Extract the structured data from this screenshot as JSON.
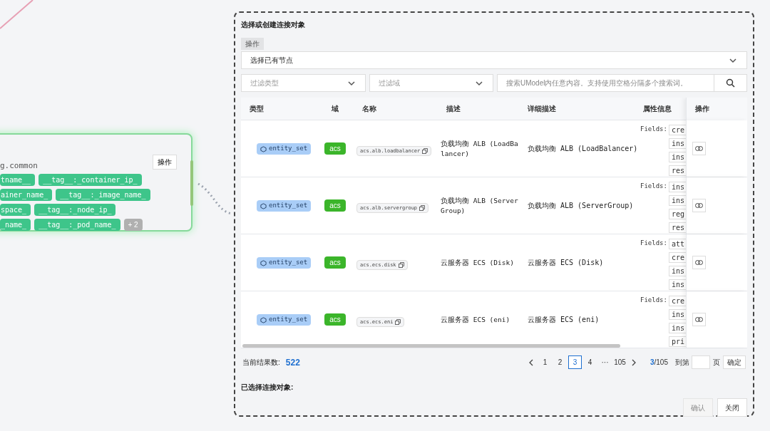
{
  "node_card": {
    "name": "g.common",
    "action": "操作",
    "tag_rows": [
      [
        "tname__",
        "__tag__:_container_ip_"
      ],
      [
        "ainer_name_",
        "__tag__:_image_name_"
      ],
      [
        "space_",
        "__tag__:_node_ip_"
      ],
      [
        "_name_",
        "__tag__:_pod_name_"
      ]
    ],
    "more": "+ 2"
  },
  "dialog": {
    "title": "选择或创建连接对象",
    "mode_label": "操作",
    "mode_select": "选择已有节点",
    "filter_type": {
      "placeholder": "过滤类型"
    },
    "filter_domain": {
      "placeholder": "过滤域"
    },
    "search": {
      "placeholder": "搜索UModel内任意内容。支持使用空格分隔多个搜索词。"
    },
    "table": {
      "columns": [
        "类型",
        "域",
        "名称",
        "描述",
        "详细描述",
        "属性信息",
        "操作"
      ],
      "rows": [
        {
          "type": "entity_set",
          "domain": "acs",
          "name": "acs.alb.loadbalancer",
          "description": "负载均衡 ALB (LoadBalancer)",
          "detail": "负载均衡 ALB (LoadBalancer)",
          "fields_label": "Fields:",
          "fields": [
            "cre",
            "ins",
            "ins",
            "res"
          ]
        },
        {
          "type": "entity_set",
          "domain": "acs",
          "name": "acs.alb.servergroup",
          "description": "负载均衡 ALB (ServerGroup)",
          "detail": "负载均衡 ALB (ServerGroup)",
          "fields_label": "Fields:",
          "fields": [
            "ins",
            "ins",
            "reg",
            "res"
          ]
        },
        {
          "type": "entity_set",
          "domain": "acs",
          "name": "acs.ecs.disk",
          "description": "云服务器 ECS (Disk)",
          "detail": "云服务器 ECS (Disk)",
          "fields_label": "Fields:",
          "fields": [
            "att",
            "cre",
            "ins",
            "ins"
          ]
        },
        {
          "type": "entity_set",
          "domain": "acs",
          "name": "acs.ecs.eni",
          "description": "云服务器 ECS (eni)",
          "detail": "云服务器 ECS (eni)",
          "fields_label": "Fields:",
          "fields": [
            "cre",
            "ins",
            "ins",
            "pri"
          ]
        }
      ]
    },
    "result_label": "当前结果数:",
    "result_count": "522",
    "pagination": {
      "pages": [
        {
          "label": "1",
          "selected": false
        },
        {
          "label": "2",
          "selected": false
        },
        {
          "label": "3",
          "selected": true
        },
        {
          "label": "4",
          "selected": false
        },
        {
          "label": "···",
          "selected": false
        },
        {
          "label": "105",
          "selected": false
        }
      ],
      "current": "3",
      "total": "/105",
      "goto_label": "到第",
      "goto_suffix": "页",
      "goto_button": "确定"
    },
    "selected_label": "已选择连接对象:",
    "buttons": [
      {
        "label": "确认",
        "disabled": true
      },
      {
        "label": "关闭",
        "disabled": false
      }
    ]
  }
}
